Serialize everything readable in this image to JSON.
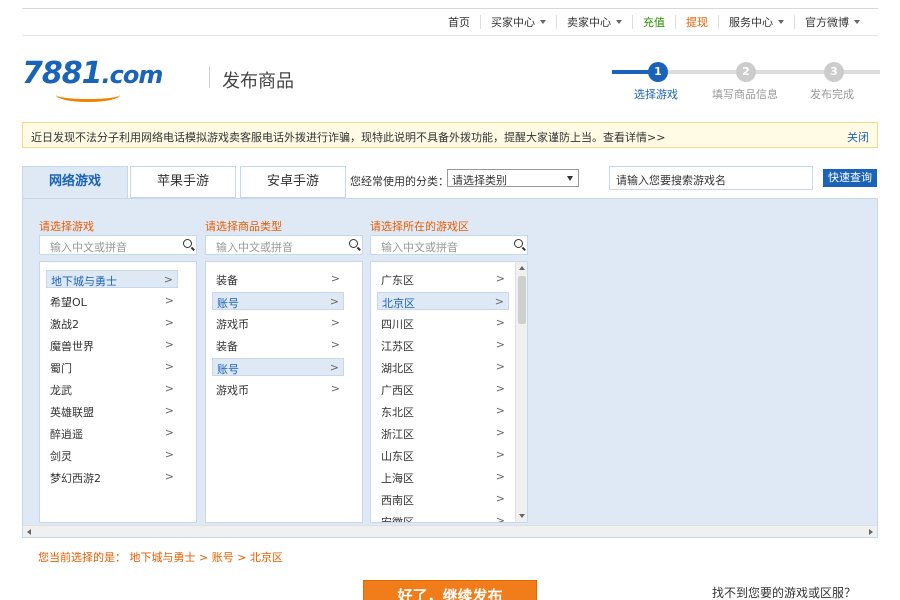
{
  "topnav": {
    "items": [
      {
        "label": "首页",
        "dropdown": false,
        "style": "normal"
      },
      {
        "label": "买家中心",
        "dropdown": true,
        "style": "normal"
      },
      {
        "label": "卖家中心",
        "dropdown": true,
        "style": "normal"
      },
      {
        "label": "充值",
        "dropdown": false,
        "style": "green"
      },
      {
        "label": "提现",
        "dropdown": false,
        "style": "orange"
      },
      {
        "label": "服务中心",
        "dropdown": true,
        "style": "normal"
      },
      {
        "label": "官方微博",
        "dropdown": true,
        "style": "normal"
      }
    ]
  },
  "header": {
    "logo_main": "7881",
    "logo_suffix": ".com",
    "page_title": "发布商品"
  },
  "steps": {
    "items": [
      {
        "number": "1",
        "label": "选择游戏",
        "active": true
      },
      {
        "number": "2",
        "label": "填写商品信息",
        "active": false
      },
      {
        "number": "3",
        "label": "发布完成",
        "active": false
      }
    ]
  },
  "notice": {
    "text": "近日发现不法分子利用网络电话模拟游戏卖客服电话外拨进行诈骗，现特此说明不具备外拨功能，提醒大家谨防上当。查看详情>>",
    "close_label": "关闭"
  },
  "tabs": [
    {
      "label": "网络游戏",
      "active": true
    },
    {
      "label": "苹果手游",
      "active": false
    },
    {
      "label": "安卓手游",
      "active": false
    }
  ],
  "frequent": {
    "label": "您经常使用的分类：",
    "selected": "请选择类别"
  },
  "game_search": {
    "value": "请输入您要搜索游戏名",
    "button_label": "快速查询"
  },
  "columns": [
    {
      "title": "请选择游戏",
      "search_placeholder": "输入中文或拼音",
      "items": [
        {
          "label": "地下城与勇士",
          "selected": true
        },
        {
          "label": "希望OL",
          "selected": false
        },
        {
          "label": "激战2",
          "selected": false
        },
        {
          "label": "魔兽世界",
          "selected": false
        },
        {
          "label": "蜀门",
          "selected": false
        },
        {
          "label": "龙武",
          "selected": false
        },
        {
          "label": "英雄联盟",
          "selected": false
        },
        {
          "label": "醉逍遥",
          "selected": false
        },
        {
          "label": "剑灵",
          "selected": false
        },
        {
          "label": "梦幻西游2",
          "selected": false
        }
      ]
    },
    {
      "title": "请选择商品类型",
      "search_placeholder": "输入中文或拼音",
      "items": [
        {
          "label": "装备",
          "selected": false
        },
        {
          "label": "账号",
          "selected": true
        },
        {
          "label": "游戏币",
          "selected": false
        },
        {
          "label": "装备",
          "selected": false
        },
        {
          "label": "账号",
          "selected": true
        },
        {
          "label": "游戏币",
          "selected": false
        }
      ]
    },
    {
      "title": "请选择所在的游戏区",
      "search_placeholder": "输入中文或拼音",
      "items": [
        {
          "label": "广东区",
          "selected": false
        },
        {
          "label": "北京区",
          "selected": true
        },
        {
          "label": "四川区",
          "selected": false
        },
        {
          "label": "江苏区",
          "selected": false
        },
        {
          "label": "湖北区",
          "selected": false
        },
        {
          "label": "广西区",
          "selected": false
        },
        {
          "label": "东北区",
          "selected": false
        },
        {
          "label": "浙江区",
          "selected": false
        },
        {
          "label": "山东区",
          "selected": false
        },
        {
          "label": "上海区",
          "selected": false
        },
        {
          "label": "西南区",
          "selected": false
        },
        {
          "label": "安徽区",
          "selected": false
        }
      ]
    }
  ],
  "chevron": ">",
  "selection_path": "您当前选择的是：  地下城与勇士 > 账号 > 北京区",
  "continue_label": "好了，继续发布",
  "cant_find": "找不到您要的游戏或区服？",
  "colors": {
    "brand_blue": "#1a63b8",
    "accent_orange": "#e85d00",
    "panel_bg": "#dfe9f6"
  }
}
